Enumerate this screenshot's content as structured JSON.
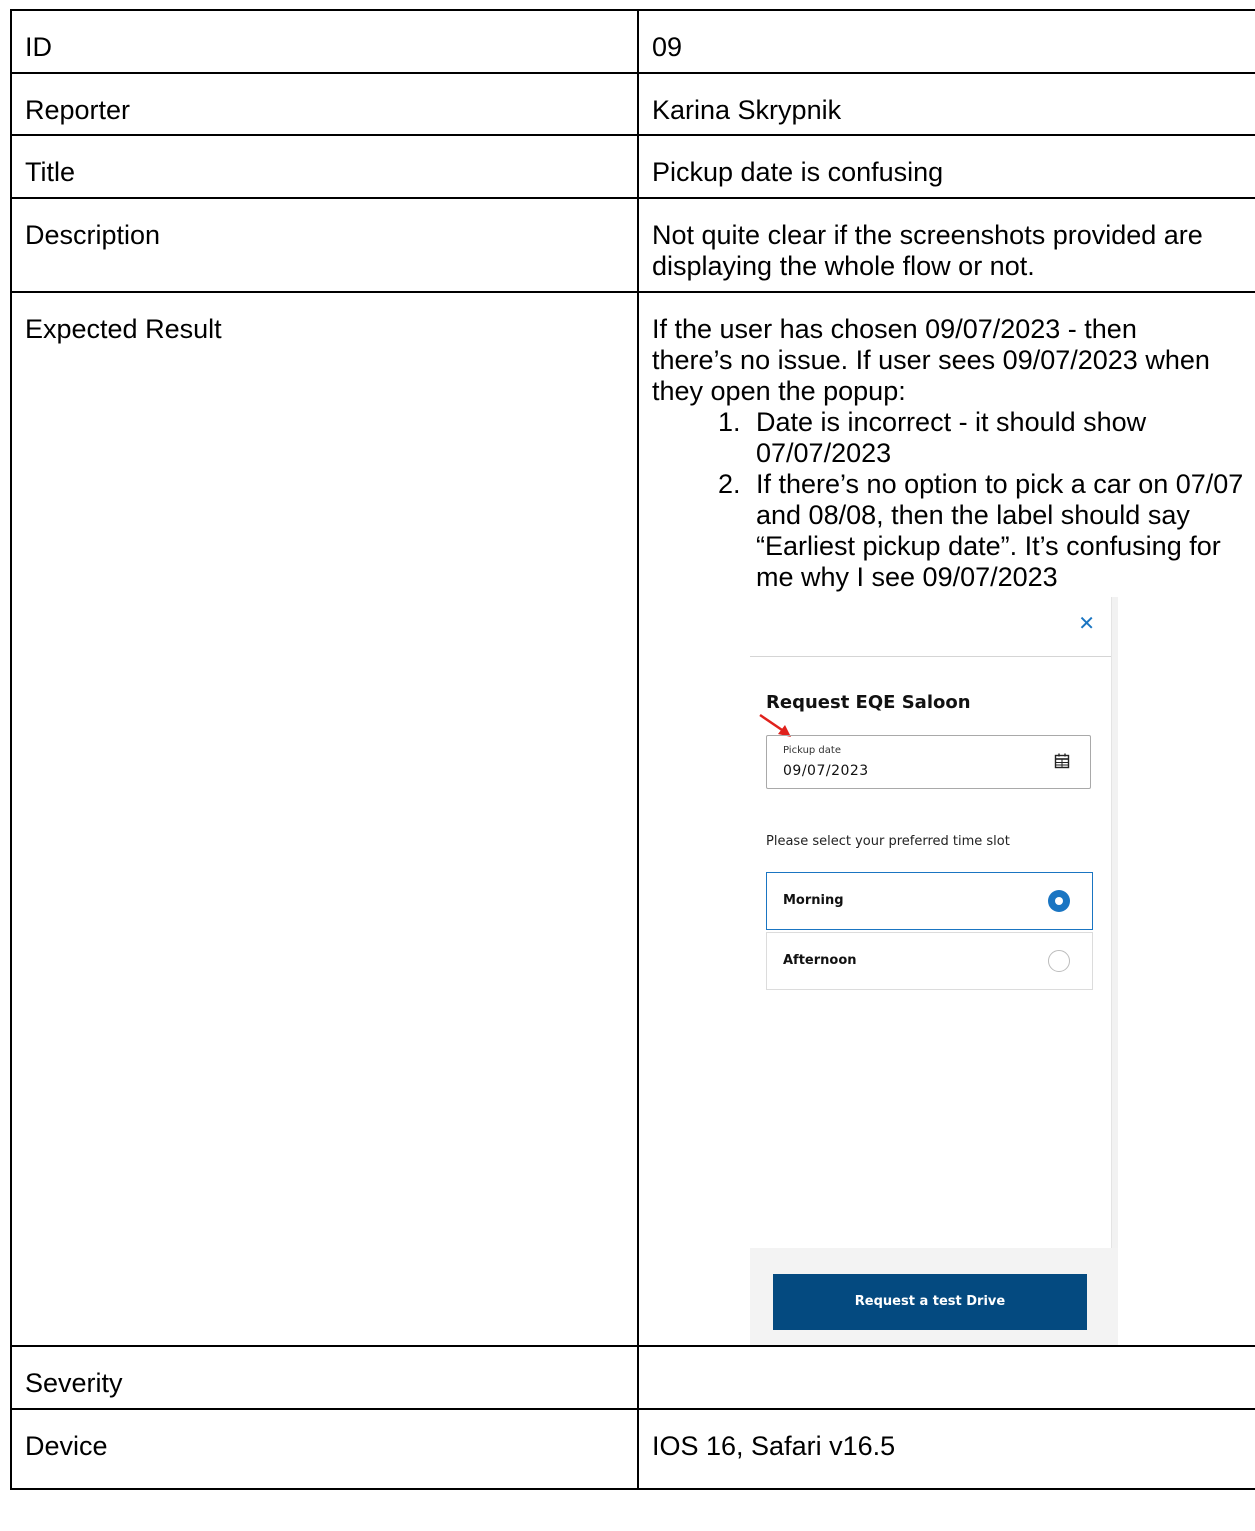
{
  "rows": {
    "id": {
      "label": "ID",
      "value": "09"
    },
    "reporter": {
      "label": "Reporter",
      "value": "Karina Skrypnik"
    },
    "title": {
      "label": "Title",
      "value": "Pickup date is confusing"
    },
    "description": {
      "label": "Description",
      "value": "Not quite clear if the screenshots provided are displaying the whole flow or not."
    },
    "expected": {
      "label": "Expected Result",
      "intro": "If the user has chosen 09/07/2023 - then there’s no issue. If user sees 09/07/2023 when they open the popup:",
      "items": [
        "Date is incorrect - it should show 07/07/2023",
        "If there’s no option to pick a car on 07/07 and 08/08, then the label should say “Earliest pickup date”. It’s confusing for me why I see 09/07/2023"
      ]
    },
    "severity": {
      "label": "Severity",
      "value": ""
    },
    "device": {
      "label": "Device",
      "value": "IOS 16, Safari v16.5"
    }
  },
  "screenshot": {
    "close_icon": "close-icon",
    "heading": "Request EQE Saloon",
    "date_field": {
      "label": "Pickup date",
      "value": "09/07/2023",
      "icon": "calendar-icon"
    },
    "slot_prompt": "Please select your preferred time slot",
    "slots": [
      {
        "label": "Morning",
        "selected": true
      },
      {
        "label": "Afternoon",
        "selected": false
      }
    ],
    "cta_label": "Request a test Drive",
    "colors": {
      "accent": "#1a75c2",
      "cta": "#044a80",
      "arrow": "#e0211c"
    }
  }
}
